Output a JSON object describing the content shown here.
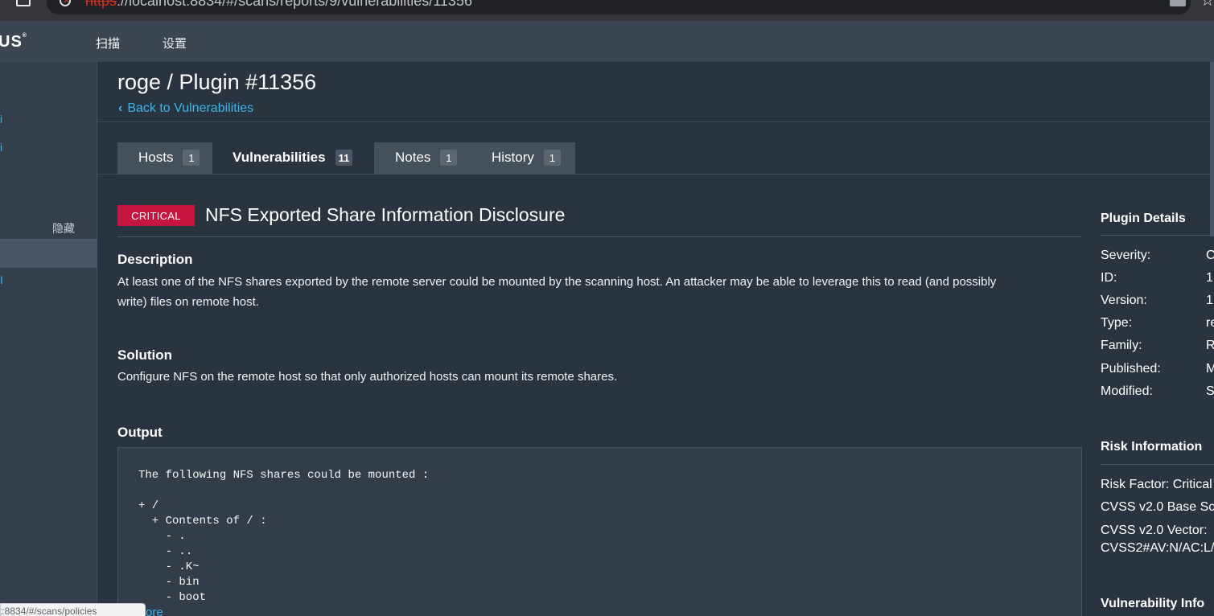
{
  "browser": {
    "url_protocol": "https",
    "url_rest": "://localhost:8834/#/scans/reports/9/vulnerabilities/11356"
  },
  "topnav": {
    "logo": "US",
    "scan": "扫描",
    "settings": "设置"
  },
  "sidebar": {
    "link1": "i",
    "link2": "i",
    "hide": "隐藏",
    "link3": "I"
  },
  "status_bar": {
    "url": "st:8834/#/scans/policies",
    "more": "ore"
  },
  "page": {
    "title": "roge / Plugin #11356",
    "back": "Back to Vulnerabilities"
  },
  "tabs": [
    {
      "label": "Hosts",
      "count": "1"
    },
    {
      "label": "Vulnerabilities",
      "count": "11"
    },
    {
      "label": "Notes",
      "count": "1"
    },
    {
      "label": "History",
      "count": "1"
    }
  ],
  "vuln": {
    "severity": "CRITICAL",
    "title": "NFS Exported Share Information Disclosure",
    "description_heading": "Description",
    "description": "At least one of the NFS shares exported by the remote server could be mounted by the scanning host. An attacker may be able to leverage this to read (and possibly write) files on remote host.",
    "solution_heading": "Solution",
    "solution": "Configure NFS on the remote host so that only authorized hosts can mount its remote shares.",
    "output_heading": "Output",
    "output": "The following NFS shares could be mounted :\n\n+ /\n  + Contents of / :\n    - .\n    - ..\n    - .K~\n    - bin\n    - boot"
  },
  "plugin_details": {
    "heading": "Plugin Details",
    "rows": [
      {
        "label": "Severity:",
        "value": "C"
      },
      {
        "label": "ID:",
        "value": "1"
      },
      {
        "label": "Version:",
        "value": "1"
      },
      {
        "label": "Type:",
        "value": "re"
      },
      {
        "label": "Family:",
        "value": "R"
      },
      {
        "label": "Published:",
        "value": "M"
      },
      {
        "label": "Modified:",
        "value": "S"
      }
    ]
  },
  "risk_info": {
    "heading": "Risk Information",
    "risk_factor": "Risk Factor: Critical",
    "cvss_base": "CVSS v2.0 Base Sco",
    "cvss_vector_label": "CVSS v2.0 Vector:",
    "cvss_vector": "CVSS2#AV:N/AC:L/"
  },
  "vuln_info": {
    "heading": "Vulnerability Info"
  },
  "colors": {
    "critical": "#c7163d",
    "link": "#3ab7e8",
    "background": "#2a3441"
  }
}
